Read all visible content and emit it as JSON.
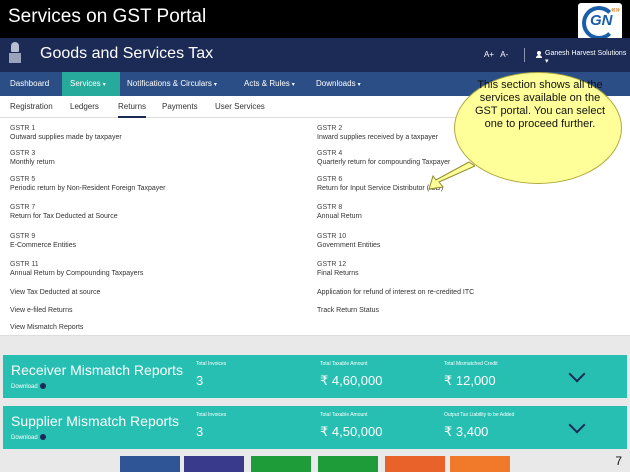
{
  "slide": {
    "title": "Services on GST Portal",
    "logo_text": "GN",
    "logo_arrows": "«»",
    "page_number": "7"
  },
  "header": {
    "title": "Goods and Services Tax",
    "font_increase": "A+",
    "font_decrease": "A-",
    "user": "Ganesh Harvest Solutions"
  },
  "nav": {
    "items": [
      {
        "label": "Dashboard"
      },
      {
        "label": "Services"
      },
      {
        "label": "Notifications & Circulars"
      },
      {
        "label": "Acts & Rules"
      },
      {
        "label": "Downloads"
      }
    ],
    "caret": "▾"
  },
  "subnav": {
    "items": [
      {
        "label": "Registration"
      },
      {
        "label": "Ledgers"
      },
      {
        "label": "Returns"
      },
      {
        "label": "Payments"
      },
      {
        "label": "User Services"
      }
    ]
  },
  "returns": {
    "left": [
      {
        "code": "GSTR 1",
        "desc": "Outward supplies made by taxpayer"
      },
      {
        "code": "GSTR 3",
        "desc": "Monthly return"
      },
      {
        "code": "GSTR 5",
        "desc": "Periodic return by Non-Resident Foreign Taxpayer"
      },
      {
        "code": "GSTR 7",
        "desc": "Return for Tax Deducted at Source"
      },
      {
        "code": "GSTR 9",
        "desc": "E-Commerce Entities"
      },
      {
        "code": "GSTR 11",
        "desc": "Annual Return by Compounding Taxpayers"
      }
    ],
    "right": [
      {
        "code": "GSTR 2",
        "desc": "Inward supplies received by a taxpayer"
      },
      {
        "code": "GSTR 4",
        "desc": "Quarterly return for compounding Taxpayer"
      },
      {
        "code": "GSTR 6",
        "desc": "Return for Input Service Distributor (ISD)"
      },
      {
        "code": "GSTR 8",
        "desc": "Annual Return"
      },
      {
        "code": "GSTR 10",
        "desc": "Government Entities"
      },
      {
        "code": "GSTR 12",
        "desc": "Final Returns"
      }
    ],
    "links_left": [
      "View Tax Deducted at source",
      "View e-filed Returns",
      "View Mismatch Reports"
    ],
    "links_right": [
      "Application for refund of interest on re-credited ITC",
      "Track Return Status"
    ]
  },
  "callout": {
    "text": "This section shows all  the services available on the GST portal. You can select one to proceed further."
  },
  "reports": [
    {
      "title": "Receiver Mismatch Reports",
      "download": "Download",
      "invoices_label": "Total Invoices",
      "invoices_value": "3",
      "taxable_label": "Total Taxable Amount",
      "taxable_value": "₹ 4,60,000",
      "third_label": "Total Mismatched Credit",
      "third_value": "₹ 12,000"
    },
    {
      "title": "Supplier Mismatch Reports",
      "download": "Download",
      "invoices_label": "Total Invoices",
      "invoices_value": "3",
      "taxable_label": "Total Taxable Amount",
      "taxable_value": "₹ 4,50,000",
      "third_label": "Output Tax Liability to be Added",
      "third_value": "₹ 3,400"
    }
  ],
  "colors": {
    "header": "#1b2b56",
    "nav": "#2c4e86",
    "active": "#27a99c",
    "card": "#26bfb1",
    "callout": "#ffff99",
    "blocks": [
      "#2f5597",
      "#3a3a8c",
      "#1e9c3a",
      "#1e9c3a",
      "#e8622a",
      "#f07a2a"
    ]
  }
}
